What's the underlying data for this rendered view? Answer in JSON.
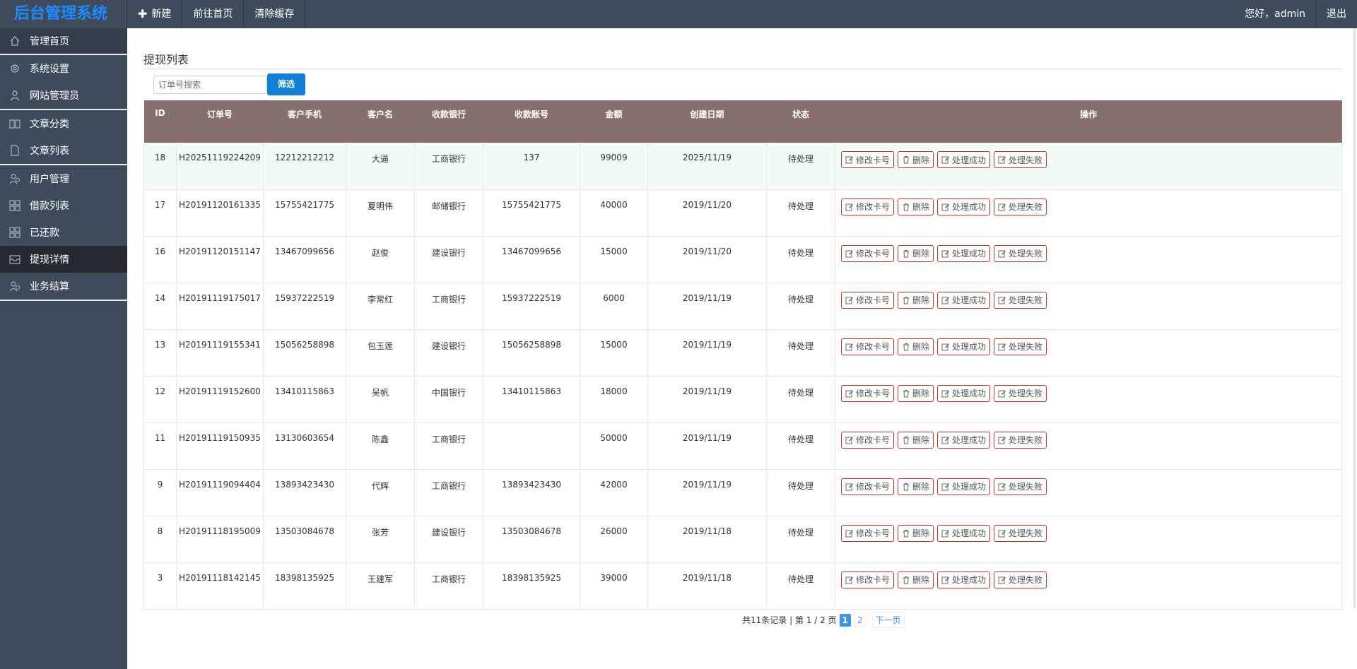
{
  "header": {
    "logo": "后台管理系统",
    "nav": [
      {
        "label": "新建",
        "icon": "plus-icon"
      },
      {
        "label": "前往首页"
      },
      {
        "label": "清除缓存"
      }
    ],
    "greeting": "您好，admin",
    "logout": "退出"
  },
  "sidebar": {
    "items": [
      {
        "label": "管理首页",
        "icon": "home-icon"
      },
      {
        "label": "系统设置",
        "icon": "gear-icon"
      },
      {
        "label": "网站管理员",
        "icon": "user-icon"
      },
      {
        "label": "文章分类",
        "icon": "book-icon"
      },
      {
        "label": "文章列表",
        "icon": "document-icon"
      },
      {
        "label": "用户管理",
        "icon": "users-icon"
      },
      {
        "label": "借款列表",
        "icon": "grid-icon"
      },
      {
        "label": "已还款",
        "icon": "grid-icon"
      },
      {
        "label": "提现详情",
        "icon": "inbox-icon"
      },
      {
        "label": "业务结算",
        "icon": "users-icon"
      }
    ]
  },
  "main": {
    "title": "提现列表",
    "search_placeholder": "订单号搜索",
    "filter_label": "筛选",
    "columns": [
      "ID",
      "订单号",
      "客户手机",
      "客户名",
      "收款银行",
      "收款账号",
      "金额",
      "创建日期",
      "状态",
      "操作"
    ],
    "actions": {
      "edit_card": "修改卡号",
      "delete": "删除",
      "success": "处理成功",
      "fail": "处理失败"
    },
    "rows": [
      {
        "id": "18",
        "order": "H20251119224209",
        "phone": "12212212212",
        "name": "大逼",
        "bank": "工商银行",
        "account": "137",
        "amount": "99009",
        "date": "2025/11/19",
        "status": "待处理"
      },
      {
        "id": "17",
        "order": "H20191120161335",
        "phone": "15755421775",
        "name": "夏明伟",
        "bank": "邮储银行",
        "account": "15755421775",
        "amount": "40000",
        "date": "2019/11/20",
        "status": "待处理"
      },
      {
        "id": "16",
        "order": "H20191120151147",
        "phone": "13467099656",
        "name": "赵俊",
        "bank": "建设银行",
        "account": "13467099656",
        "amount": "15000",
        "date": "2019/11/20",
        "status": "待处理"
      },
      {
        "id": "14",
        "order": "H20191119175017",
        "phone": "15937222519",
        "name": "李常红",
        "bank": "工商银行",
        "account": "15937222519",
        "amount": "6000",
        "date": "2019/11/19",
        "status": "待处理"
      },
      {
        "id": "13",
        "order": "H20191119155341",
        "phone": "15056258898",
        "name": "包玉莲",
        "bank": "建设银行",
        "account": "15056258898",
        "amount": "15000",
        "date": "2019/11/19",
        "status": "待处理"
      },
      {
        "id": "12",
        "order": "H20191119152600",
        "phone": "13410115863",
        "name": "吴帆",
        "bank": "中国银行",
        "account": "13410115863",
        "amount": "18000",
        "date": "2019/11/19",
        "status": "待处理"
      },
      {
        "id": "11",
        "order": "H20191119150935",
        "phone": "13130603654",
        "name": "陈鑫",
        "bank": "工商银行",
        "account": "",
        "amount": "50000",
        "date": "2019/11/19",
        "status": "待处理"
      },
      {
        "id": "9",
        "order": "H20191119094404",
        "phone": "13893423430",
        "name": "代辉",
        "bank": "工商银行",
        "account": "13893423430",
        "amount": "42000",
        "date": "2019/11/19",
        "status": "待处理"
      },
      {
        "id": "8",
        "order": "H20191118195009",
        "phone": "13503084678",
        "name": "张芳",
        "bank": "建设银行",
        "account": "13503084678",
        "amount": "26000",
        "date": "2019/11/18",
        "status": "待处理"
      },
      {
        "id": "3",
        "order": "H20191118142145",
        "phone": "18398135925",
        "name": "王建军",
        "bank": "工商银行",
        "account": "18398135925",
        "amount": "39000",
        "date": "2019/11/18",
        "status": "待处理"
      }
    ],
    "pager": {
      "summary": "共11条记录 | 第 1 / 2 页",
      "current": "1",
      "page2": "2",
      "next": "下一页"
    }
  }
}
